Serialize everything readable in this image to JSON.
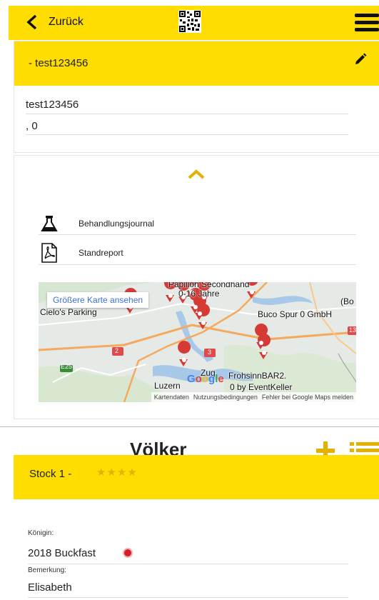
{
  "topbar": {
    "back_label": "Zurück",
    "qr_icon": "qr-code-icon",
    "menu_icon": "hamburger-icon"
  },
  "stand": {
    "header": "- test123456",
    "name": "test123456",
    "coords": ", 0"
  },
  "actions": [
    {
      "label": "Behandlungsjournal",
      "icon": "flask-icon"
    },
    {
      "label": "Standreport",
      "icon": "pdf-icon"
    }
  ],
  "map": {
    "view_larger": "Größere Karte ansehen",
    "places": [
      "Papillon Secondhand",
      "0-16 Jahre",
      "Buco Spur 0 GmbH",
      "Luzern",
      "Zug",
      "FrohsinnBAR2.",
      "0 by EventKeller",
      "Cielo's Parking",
      "(Bo",
      "E25",
      "2",
      "3",
      "13"
    ],
    "footer": [
      "Kartendaten",
      "Nutzungsbedingungen",
      "Fehler bei Google Maps melden"
    ],
    "logo": "Google"
  },
  "voelker": {
    "title": "Völker",
    "hive": {
      "name": "Stock 1 -",
      "stars": "★★★★",
      "queen_label": "Königin:",
      "queen_value": "2018 Buckfast",
      "note_label": "Bemerkung:",
      "note_value": "Elisabeth"
    }
  },
  "colors": {
    "accent": "#ffdd00",
    "marker": "#d63a35",
    "link": "#3a6fd8"
  }
}
